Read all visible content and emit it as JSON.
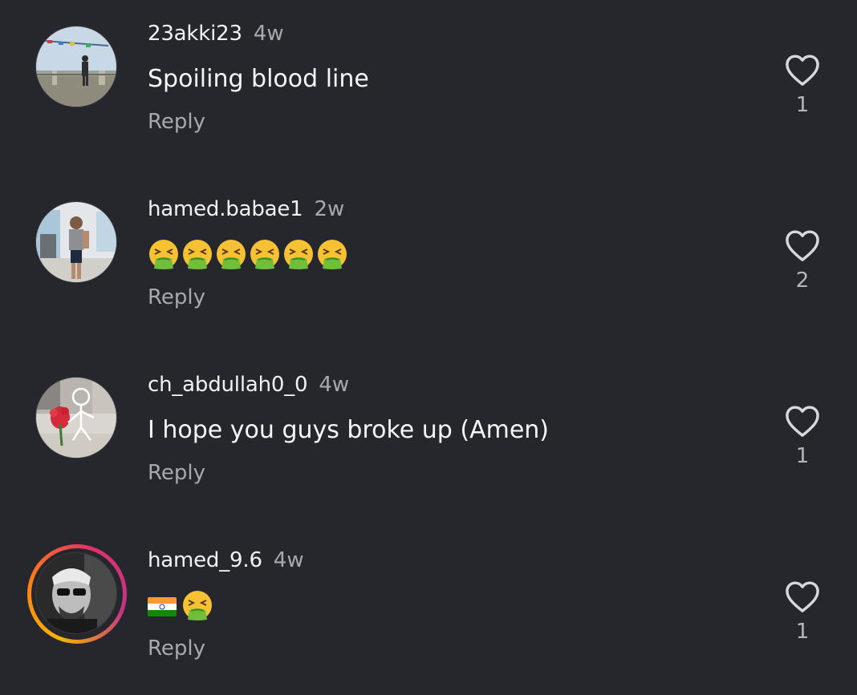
{
  "comments": [
    {
      "username": "23akki23",
      "time": "4w",
      "text": "Spoiling blood line",
      "reply_label": "Reply",
      "likes": "1",
      "avatar_icon": "person-landscape-photo"
    },
    {
      "username": "hamed.babae1",
      "time": "2w",
      "emojis": [
        "vomiting-face",
        "vomiting-face",
        "vomiting-face",
        "vomiting-face",
        "vomiting-face",
        "vomiting-face"
      ],
      "reply_label": "Reply",
      "likes": "2",
      "avatar_icon": "gym-selfie-photo"
    },
    {
      "username": "ch_abdullah0_0",
      "time": "4w",
      "text": "I hope you guys broke up (Amen)",
      "reply_label": "Reply",
      "likes": "1",
      "avatar_icon": "stick-figure-flowers-photo"
    },
    {
      "username": "hamed_9.6",
      "time": "4w",
      "emojis": [
        "india-flag",
        "vomiting-face"
      ],
      "reply_label": "Reply",
      "likes": "1",
      "avatar_icon": "bw-portrait-story",
      "has_story_ring": true
    }
  ],
  "colors": {
    "background": "#25272c",
    "text_primary": "#f2f2f2",
    "text_secondary": "#a8a8ad",
    "heart_outline": "#d8d8dc"
  }
}
